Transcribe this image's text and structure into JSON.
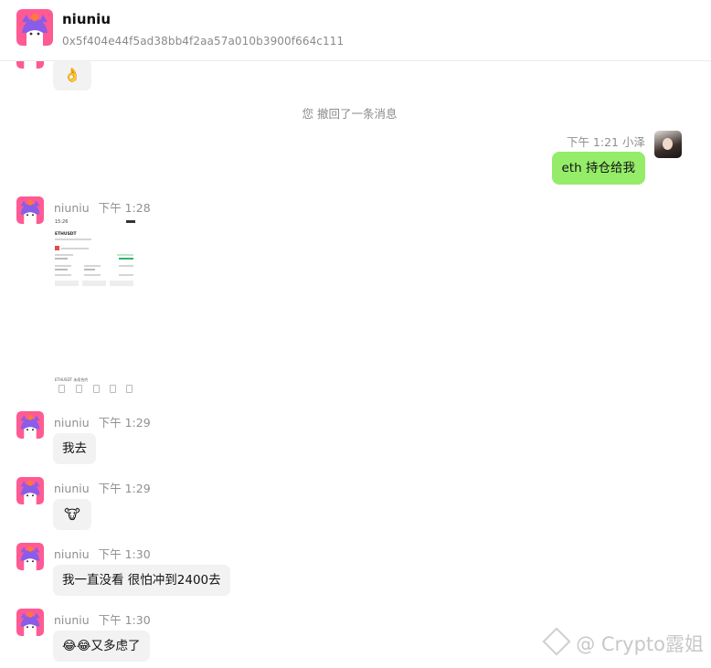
{
  "contact": {
    "name": "niuniu",
    "address": "0x5f404e44f5ad38bb4f2aa57a010b3900f664c111"
  },
  "recall_notice": "您 撤回了一条消息",
  "my_message": {
    "time": "下午 1:21",
    "sender": "小泽",
    "text": "eth 持仓给我"
  },
  "messages": [
    {
      "sender": "niuniu",
      "time": "下午 1:28",
      "type": "image"
    },
    {
      "sender": "niuniu",
      "time": "下午 1:29",
      "text": "我去"
    },
    {
      "sender": "niuniu",
      "time": "下午 1:29",
      "text": "🐮"
    },
    {
      "sender": "niuniu",
      "time": "下午 1:30",
      "text": "我一直没看 很怕冲到2400去"
    },
    {
      "sender": "niuniu",
      "time": "下午 1:30",
      "text": "😂😂又多虑了"
    }
  ],
  "partial_top_message": {
    "text": "👌"
  },
  "screenshot_preview": {
    "status_time": "15:26",
    "ticker": "ETHUSDT",
    "footer_label": "ETHUSDT 永续合约"
  },
  "watermark": "@ Crypto露姐",
  "colors": {
    "my_bubble": "#95ec69",
    "other_bubble": "#f2f2f2",
    "avatar_pink": "#ff5a94"
  }
}
